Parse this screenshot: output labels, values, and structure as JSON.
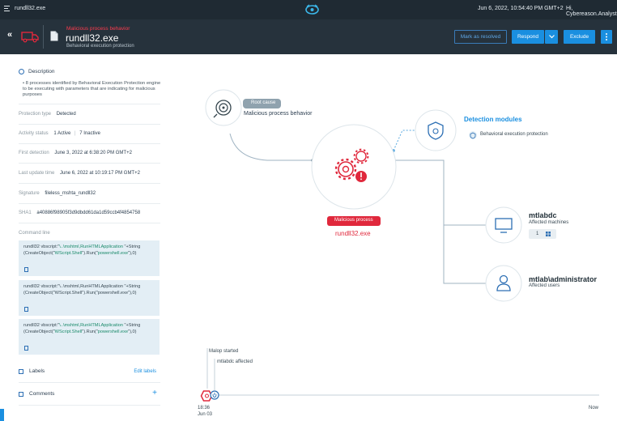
{
  "topbar": {
    "title": "rundll32.exe",
    "datetime": "Jun 6, 2022, 10:54:40 PM GMT+2",
    "user": "Hi, Cybereason.Analyst"
  },
  "header": {
    "tag": "Malicious process behavior",
    "name": "rundll32.exe",
    "subtitle": "Behavioral execution protection",
    "resolve_label": "Mark as resolved",
    "respond_label": "Respond",
    "exclude_label": "Exclude"
  },
  "left": {
    "description_title": "Description",
    "description_text": "• 8 processes identified by Behavioral Execution Protection engine to be executing with parameters that are indicating for malicious purposes",
    "protection_type": {
      "label": "Protection type",
      "value": "Detected"
    },
    "activity_status": {
      "label": "Activity status",
      "active": "1 Active",
      "inactive": "7 Inactive"
    },
    "first_detection": {
      "label": "First detection",
      "value": "June 3, 2022 at 6:38:20 PM GMT+2"
    },
    "last_update": {
      "label": "Last update time",
      "value": "June 6, 2022 at 10:19:17 PM GMT+2"
    },
    "signature": {
      "label": "Signature",
      "value": "fileless_mshta_rundll32"
    },
    "sha1": {
      "label": "SHA1",
      "value": "a40886f98905f3d9dbdd61da1d59ccb4f4854758"
    },
    "command_line_label": "Command line",
    "commands": [
      {
        "a": "rundll32 vbscript:\"",
        "b": "\\..\\mshtml,RunHTMLApplication ",
        "c": "\"+String",
        "d": "(CreateObject(\"",
        "e": "WScript.Shell",
        "f": "\").Run(\"",
        "g": "powershell.exe",
        "h": "\"),0)"
      },
      {
        "a": "rundll32 vbscript:\"",
        "b": "\\..\\mshtml,RunHTMLApplication ",
        "c": "\"+String",
        "d": "(CreateObject(\"",
        "e": "WScript.Shell",
        "f": "\").Run(\"",
        "g": "powershell.exe",
        "h": "\"),0)"
      },
      {
        "a": "rundll32 vbscript:\"",
        "b": "\\..\\mshtml,RunHTMLApplication ",
        "c": "\"+String",
        "d": "(CreateObject(\"",
        "e": "WScript.Shell",
        "f": "\").Run(\"",
        "g": "powershell.exe",
        "h": "\"),0)"
      }
    ],
    "labels_title": "Labels",
    "edit_labels": "Edit labels",
    "comments_title": "Comments",
    "comments_add": "+"
  },
  "graph": {
    "root_cause_tag": "Root cause",
    "root_cause_label": "Malicious process behavior",
    "detection_title": "Detection modules",
    "detection_item": "Behavioral execution protection",
    "process_tag": "Malicious process",
    "process_name": "rundll32.exe",
    "machine_name": "mtlabdc",
    "machine_sub": "Affected machines",
    "machine_count": "1",
    "user_name": "mtlab\\administrator",
    "user_sub": "Affected users"
  },
  "timeline": {
    "event1": "Malop started",
    "event2": "mtlabdc affected",
    "start_time": "18:36",
    "start_date": "Jun 03",
    "end_label": "Now"
  },
  "colors": {
    "accent": "#1a8fe0",
    "danger": "#e0283c",
    "dark": "#26323c"
  }
}
